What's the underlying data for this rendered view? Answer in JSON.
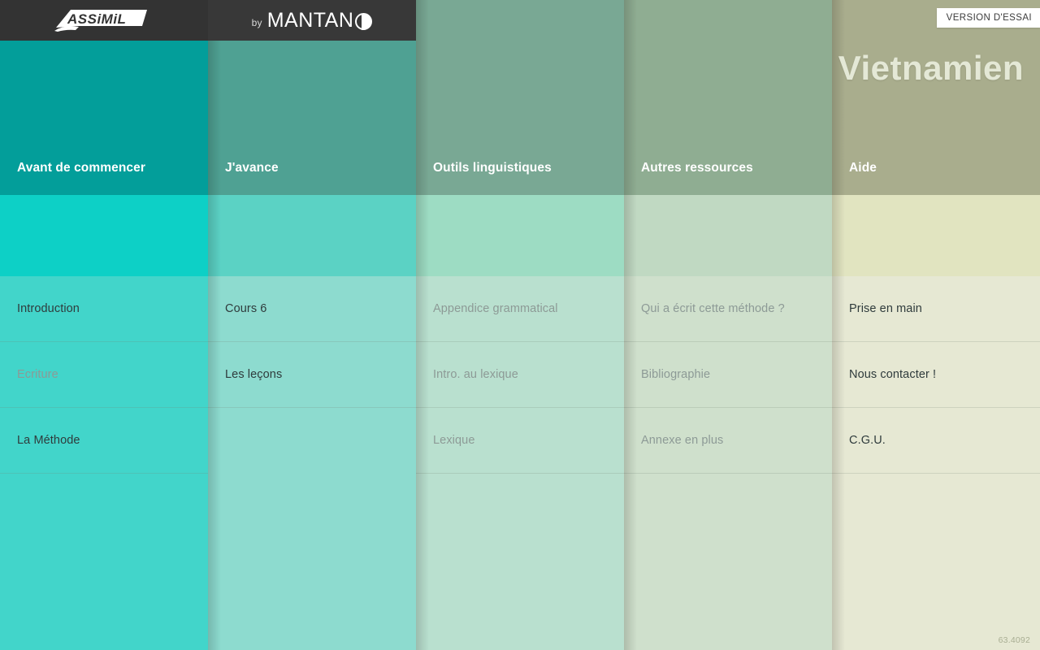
{
  "window": {
    "version": "63.4092"
  },
  "branding": {
    "assimil_logo": "assimil-logo",
    "by_label": "by",
    "mantano_label": "MANTAN"
  },
  "header": {
    "trial_badge": "VERSION D'ESSAI",
    "language_title": "Vietnamien"
  },
  "colors": {
    "col1_header": "#039e9a",
    "col1_hero": "#0dd0c6",
    "col1_list": "#42d5ca",
    "col2_header": "#4fa193",
    "col2_hero": "#5bd2c4",
    "col2_list": "#8ddbcf",
    "col3_header": "#79a894",
    "col3_hero": "#9ddcc3",
    "col3_list": "#b9e0cf",
    "col4_header": "#8fad92",
    "col4_hero": "#c0d9c2",
    "col4_list": "#cfe0cc",
    "col5_header": "#a9ad8d",
    "col5_hero": "#e1e4c0",
    "col5_list": "#e6e8d3",
    "topbar_left": "#333333",
    "topbar_right": "#383838",
    "title_text": "#e4e8d6",
    "item_enabled": "#2f3b3c",
    "item_disabled": "#8d9a96"
  },
  "columns": [
    {
      "title": "Avant de commencer",
      "items": [
        {
          "label": "Introduction",
          "state": "enabled"
        },
        {
          "label": "Ecriture",
          "state": "disabled"
        },
        {
          "label": "La Méthode",
          "state": "enabled"
        }
      ]
    },
    {
      "title": "J'avance",
      "items": [
        {
          "label": "Cours 6",
          "state": "enabled"
        },
        {
          "label": "Les leçons",
          "state": "enabled"
        }
      ]
    },
    {
      "title": "Outils linguistiques",
      "items": [
        {
          "label": "Appendice grammatical",
          "state": "disabled"
        },
        {
          "label": "Intro. au lexique",
          "state": "disabled"
        },
        {
          "label": "Lexique",
          "state": "disabled"
        }
      ]
    },
    {
      "title": "Autres ressources",
      "items": [
        {
          "label": "Qui a écrit cette méthode ?",
          "state": "disabled"
        },
        {
          "label": "Bibliographie",
          "state": "disabled"
        },
        {
          "label": "Annexe en plus",
          "state": "disabled"
        }
      ]
    },
    {
      "title": "Aide",
      "items": [
        {
          "label": "Prise en main",
          "state": "enabled"
        },
        {
          "label": "Nous contacter !",
          "state": "enabled"
        },
        {
          "label": "C.G.U.",
          "state": "enabled"
        }
      ]
    }
  ]
}
